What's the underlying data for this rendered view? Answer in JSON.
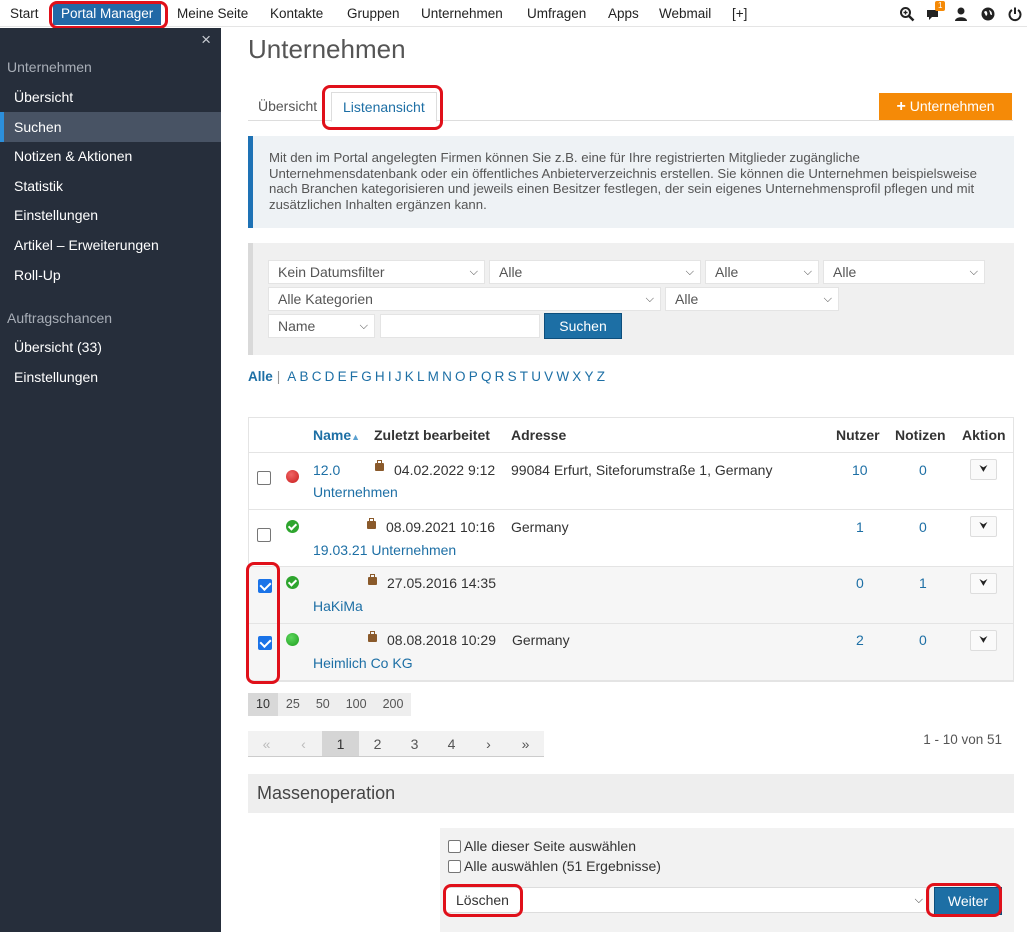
{
  "topnav": {
    "items": [
      "Start",
      "Portal Manager",
      "Meine Seite",
      "Kontakte",
      "Gruppen",
      "Unternehmen",
      "Umfragen",
      "Apps",
      "Webmail",
      "[+]"
    ],
    "active": "Portal Manager",
    "notification_count": "1"
  },
  "sidebar": {
    "close_label": "×",
    "section1": "Unternehmen",
    "items1": [
      "Übersicht",
      "Suchen",
      "Notizen & Aktionen",
      "Statistik",
      "Einstellungen",
      "Artikel – Erweiterungen",
      "Roll-Up"
    ],
    "active_item": "Suchen",
    "section2": "Auftragschancen",
    "items2": [
      "Übersicht (33)",
      "Einstellungen"
    ]
  },
  "page": {
    "title": "Unternehmen",
    "tabs": [
      "Übersicht",
      "Listenansicht"
    ],
    "active_tab": "Listenansicht",
    "add_button": "Unternehmen",
    "info_text": "Mit den im Portal angelegten Firmen können Sie z.B. eine für Ihre registrierten Mitglieder zugängliche Unternehmensdatenbank oder ein öffentliches Anbieterverzeichnis erstellen. Sie können die Unternehmen beispielsweise nach Branchen kategorisieren und jeweils einen Besitzer festlegen, der sein eigenes Unternehmensprofil pflegen und mit zusätzlichen Inhalten ergänzen kann."
  },
  "filters": {
    "date": "Kein Datumsfilter",
    "alle1": "Alle",
    "alle2": "Alle",
    "alle3": "Alle",
    "categories": "Alle Kategorien",
    "alle4": "Alle",
    "field": "Name",
    "search_value": "",
    "search_button": "Suchen"
  },
  "alphabet": {
    "all": "Alle",
    "letters": [
      "A",
      "B",
      "C",
      "D",
      "E",
      "F",
      "G",
      "H",
      "I",
      "J",
      "K",
      "L",
      "M",
      "N",
      "O",
      "P",
      "Q",
      "R",
      "S",
      "T",
      "U",
      "V",
      "W",
      "X",
      "Y",
      "Z"
    ]
  },
  "table": {
    "headers": {
      "name": "Name",
      "edited": "Zuletzt bearbeitet",
      "address": "Adresse",
      "users": "Nutzer",
      "notes": "Notizen",
      "action": "Aktion"
    },
    "rows": [
      {
        "checked": false,
        "status": "red",
        "name_line1": "12.0",
        "name_line2": "Unternehmen",
        "edited": "04.02.2022 9:12",
        "address": "99084 Erfurt, Siteforumstraße 1, Germany",
        "users": "10",
        "notes": "0"
      },
      {
        "checked": false,
        "status": "check",
        "name_line1": "",
        "name_line2": "19.03.21 Unternehmen",
        "edited": "08.09.2021 10:16",
        "address": "Germany",
        "users": "1",
        "notes": "0"
      },
      {
        "checked": true,
        "status": "check",
        "name_line1": "",
        "name_line2": "HaKiMa",
        "edited": "27.05.2016 14:35",
        "address": "",
        "users": "0",
        "notes": "1"
      },
      {
        "checked": true,
        "status": "green",
        "name_line1": "",
        "name_line2": "Heimlich Co KG",
        "edited": "08.08.2018 10:29",
        "address": "Germany",
        "users": "2",
        "notes": "0"
      }
    ]
  },
  "pagination": {
    "sizes": [
      "10",
      "25",
      "50",
      "100",
      "200"
    ],
    "active_size": "10",
    "pages": [
      "«",
      "‹",
      "1",
      "2",
      "3",
      "4",
      "›",
      "»"
    ],
    "active_page": "1",
    "count_text": "1 - 10 von 51"
  },
  "mass": {
    "title": "Massenoperation",
    "select_page": "Alle dieser Seite auswählen",
    "select_all": "Alle auswählen (51 Ergebnisse)",
    "operation": "Löschen",
    "submit": "Weiter"
  },
  "colors": {
    "brand_blue": "#1d6fa5",
    "accent_orange": "#f58a07",
    "sidebar_bg": "#262e3b",
    "highlight_red": "#e0101a"
  }
}
